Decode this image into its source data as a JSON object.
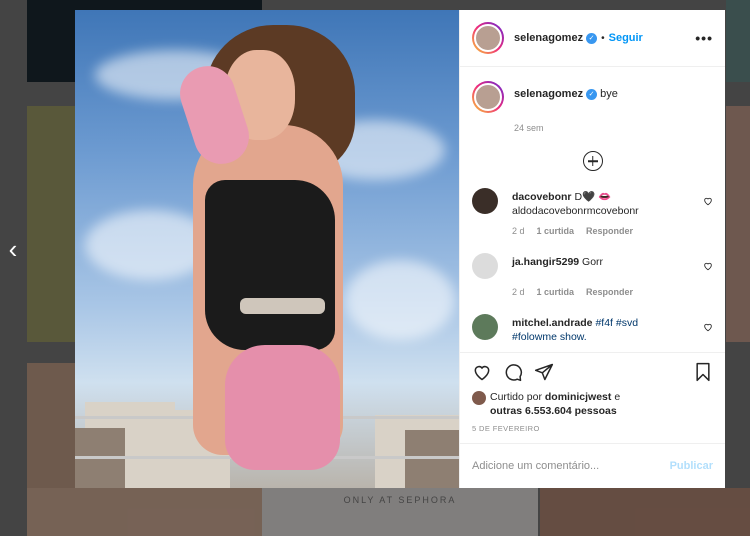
{
  "nav": {
    "prev_arrow": "‹"
  },
  "background": {
    "banner_text": "ONLY AT SEPHORA"
  },
  "post": {
    "username": "selenagomez",
    "verified_mark": "✓",
    "separator": "•",
    "follow_label": "Seguir",
    "more_label": "•••",
    "caption": "bye",
    "caption_age": "24 sem",
    "comments": [
      {
        "username": "dacovebonr",
        "text": "D🖤 👄",
        "text2": "aldodacovebonrmcovebonr",
        "age": "2 d",
        "likes": "1 curtida",
        "reply": "Responder",
        "avatar_color": "#3a2e28"
      },
      {
        "username": "ja.hangir5299",
        "text": "Gorr",
        "text2": "",
        "age": "2 d",
        "likes": "1 curtida",
        "reply": "Responder",
        "avatar_color": "#dcdcdc"
      },
      {
        "username": "mitchel.andrade",
        "text": "#f4f #svd",
        "text2": "#folowme show.",
        "age": "",
        "likes": "",
        "reply": "",
        "avatar_color": "#5d7a5b"
      }
    ],
    "liked_by_prefix": "Curtido por",
    "liked_by_user": "dominicjwest",
    "liked_by_join": "e",
    "liked_by_others": "outras 6.553.604 pessoas",
    "date": "5 DE FEVEREIRO",
    "comment_placeholder": "Adicione um comentário...",
    "publish_label": "Publicar"
  },
  "colors": {
    "link": "#0095f6",
    "verified": "#3897f0",
    "muted": "#8e8e8e",
    "text": "#262626"
  }
}
